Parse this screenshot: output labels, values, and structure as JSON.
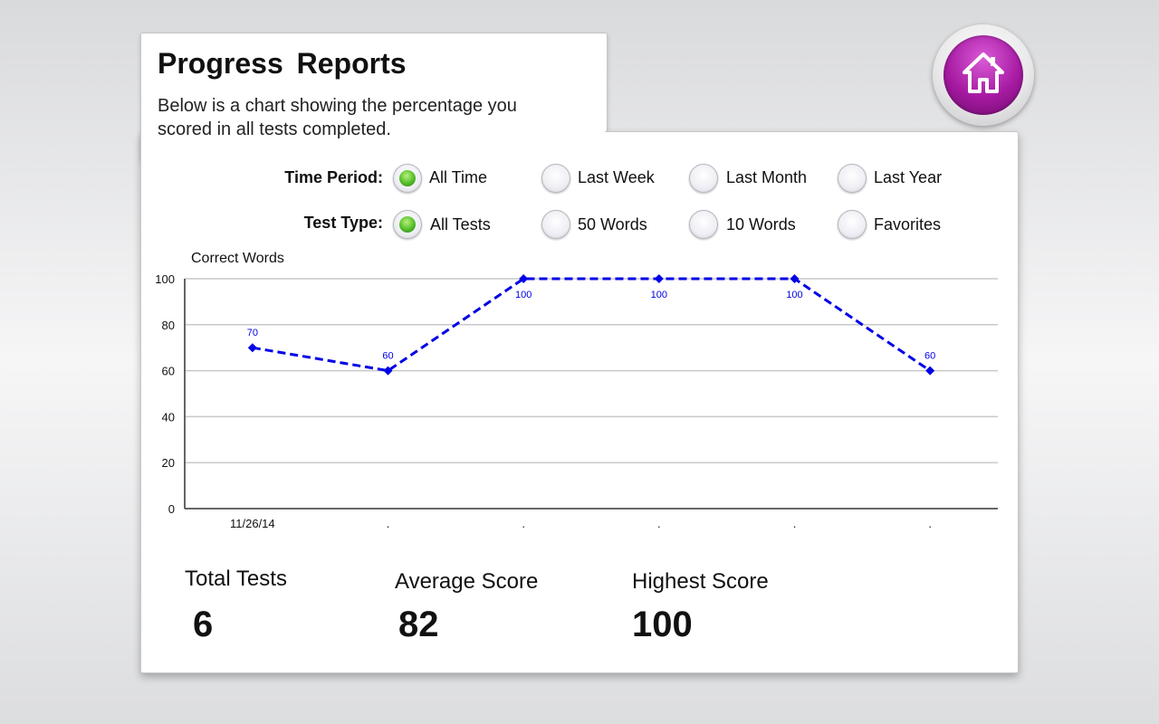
{
  "header": {
    "title": "Progress Reports",
    "subtitle": "Below is a chart showing the percentage you scored in all tests completed."
  },
  "home_button": {
    "icon": "home-icon",
    "color": "#a61aa2"
  },
  "filters": {
    "time_period": {
      "label": "Time Period:",
      "options": [
        "All Time",
        "Last Week",
        "Last Month",
        "Last Year"
      ],
      "selected": "All Time"
    },
    "test_type": {
      "label": "Test Type:",
      "options": [
        "All Tests",
        "50 Words",
        "10 Words",
        "Favorites"
      ],
      "selected": "All Tests"
    }
  },
  "chart_data": {
    "type": "line",
    "ylabel": "Correct Words",
    "categories": [
      "11/26/14",
      ".",
      ".",
      ".",
      ".",
      "."
    ],
    "values": [
      70,
      60,
      100,
      100,
      100,
      60
    ],
    "ylim": [
      0,
      100
    ],
    "yticks": [
      0,
      20,
      40,
      60,
      80,
      100
    ],
    "grid": true,
    "line_style": "dashed",
    "marker": "diamond",
    "color": "#0000e6"
  },
  "stats": {
    "total_tests": {
      "label": "Total Tests",
      "value": "6"
    },
    "average_score": {
      "label": "Average Score",
      "value": "82"
    },
    "highest_score": {
      "label": "Highest Score",
      "value": "100"
    }
  }
}
